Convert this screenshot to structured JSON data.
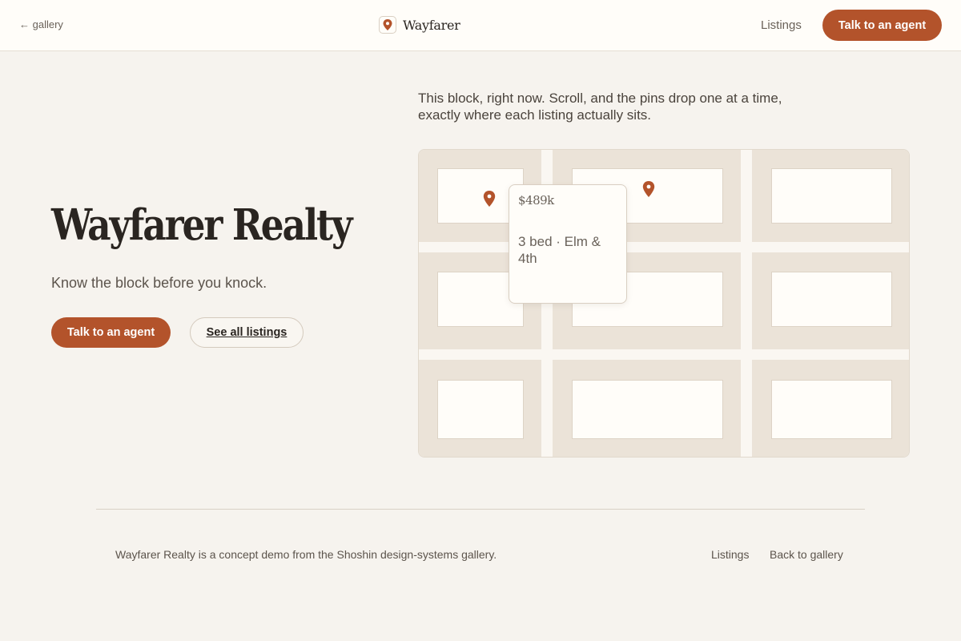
{
  "nav": {
    "back_label": "← gallery",
    "brand_name": "Wayfarer",
    "listings_label": "Listings",
    "cta_label": "Talk to an agent"
  },
  "hero": {
    "title": "Wayfarer Realty",
    "subtitle": "Know the block before you knock.",
    "primary_button": "Talk to an agent",
    "secondary_button": "See all listings"
  },
  "map": {
    "caption": "This block, right now. Scroll, and the pins drop one at a time, exactly where each listing actually sits.",
    "pin_icon": "map-pin-icon",
    "popup": {
      "price": "$489k",
      "detail": "3 bed · Elm & 4th"
    }
  },
  "footer": {
    "text": "Wayfarer Realty is a concept demo from the Shoshin design-systems gallery.",
    "listings_label": "Listings",
    "back_label": "Back to gallery"
  },
  "colors": {
    "accent": "#b3532b",
    "background": "#f6f3ee",
    "block": "#ebe3d8"
  }
}
